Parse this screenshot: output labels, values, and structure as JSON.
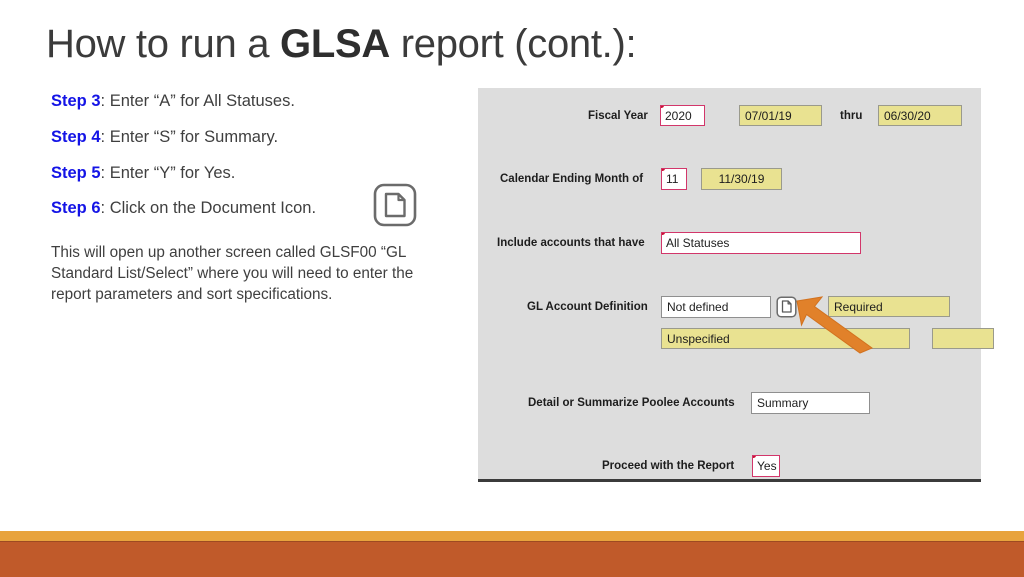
{
  "slide": {
    "title_before": "How to run a ",
    "title_strong": "GLSA",
    "title_after": " report (cont.):"
  },
  "steps": [
    {
      "key": "Step 3",
      "text": ": Enter “A” for All Statuses."
    },
    {
      "key": "Step 4",
      "text": ": Enter “S” for Summary."
    },
    {
      "key": "Step 5",
      "text": ": Enter “Y” for Yes."
    },
    {
      "key": "Step 6",
      "text": ": Click on the Document Icon."
    }
  ],
  "note": "This will open up another screen called GLSF00 “GL Standard List/Select” where you will need to enter the report parameters and sort specifications.",
  "form": {
    "fiscal_year": {
      "label": "Fiscal Year",
      "value": "2020",
      "date_from": "07/01/19",
      "thru_word": "thru",
      "date_to": "06/30/20"
    },
    "calendar_month": {
      "label": "Calendar Ending Month of",
      "value": "11",
      "date_display": "11/30/19"
    },
    "include_accounts": {
      "label": "Include accounts that have",
      "value": "All Statuses"
    },
    "gl_account_definition": {
      "label": "GL Account Definition",
      "value": "Not defined",
      "doc_icon": "document-icon",
      "required_display": "Required",
      "unspecified_display": "Unspecified",
      "extra_display": ""
    },
    "poolee_accounts": {
      "label": "Detail or Summarize Poolee Accounts",
      "value": "Summary"
    },
    "proceed": {
      "label": "Proceed with the Report",
      "value": "Yes"
    }
  },
  "icons": {
    "step_document": "document-icon",
    "annotation": "orange-arrow-icon"
  },
  "colors": {
    "step_key": "#1414e6",
    "panel_bg": "#dddddd",
    "yellow_field": "#e9e291",
    "input_border": "#d2366a",
    "arrow": "#e1812a",
    "bottom_stripe": "#e8a33d",
    "bottom_band": "#c05a2a"
  }
}
